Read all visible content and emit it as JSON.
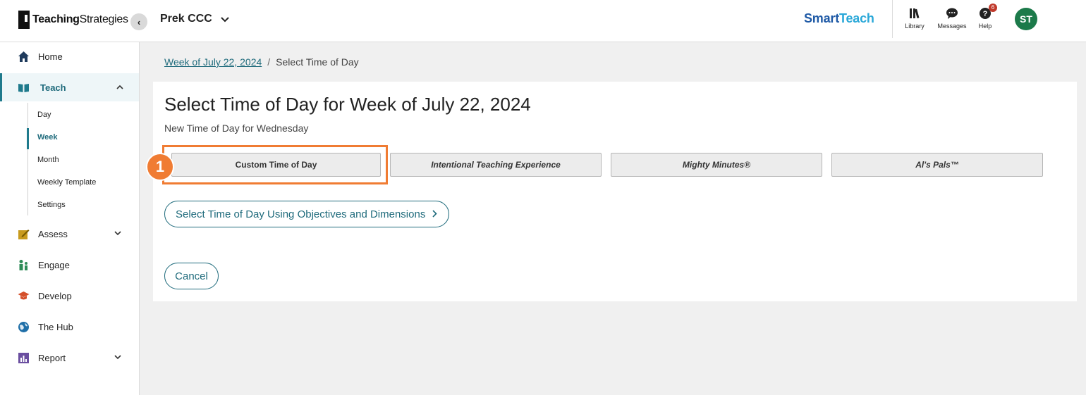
{
  "header": {
    "logo_text_bold": "Teaching",
    "logo_text_rest": "Strategies",
    "collapse_icon": "chevron-left-icon",
    "class_name": "Prek CCC",
    "brand_main": "Smart",
    "brand_accent": "Teach",
    "icons": [
      {
        "name": "library-icon",
        "label": "Library"
      },
      {
        "name": "messages-icon",
        "label": "Messages"
      },
      {
        "name": "help-icon",
        "label": "Help",
        "badge": "6"
      }
    ],
    "avatar_initials": "ST"
  },
  "sidebar": {
    "items": [
      {
        "label": "Home",
        "icon": "home-icon"
      },
      {
        "label": "Teach",
        "icon": "book-icon"
      },
      {
        "label": "Assess",
        "icon": "pencil-note-icon"
      },
      {
        "label": "Engage",
        "icon": "family-icon"
      },
      {
        "label": "Develop",
        "icon": "graduation-cap-icon"
      },
      {
        "label": "The Hub",
        "icon": "globe-icon"
      },
      {
        "label": "Report",
        "icon": "bar-chart-icon"
      }
    ],
    "teach_sub": [
      "Day",
      "Week",
      "Month",
      "Weekly Template",
      "Settings"
    ]
  },
  "breadcrumb": {
    "link": "Week of July 22, 2024",
    "separator": "/",
    "current": "Select Time of Day"
  },
  "main": {
    "title": "Select Time of Day for Week of July 22, 2024",
    "subtitle": "New Time of Day for Wednesday",
    "step_number": "1",
    "tod_buttons": [
      "Custom Time of Day",
      "Intentional Teaching Experience",
      "Mighty Minutes®",
      "Al's Pals™"
    ],
    "objectives_label": "Select Time of Day Using Objectives and Dimensions",
    "cancel_label": "Cancel"
  },
  "colors": {
    "accent": "#1f6b7c",
    "highlight": "#f07c33",
    "brand": "#1f5aa6",
    "avatar": "#1c7a4a",
    "badge": "#c0392b"
  }
}
